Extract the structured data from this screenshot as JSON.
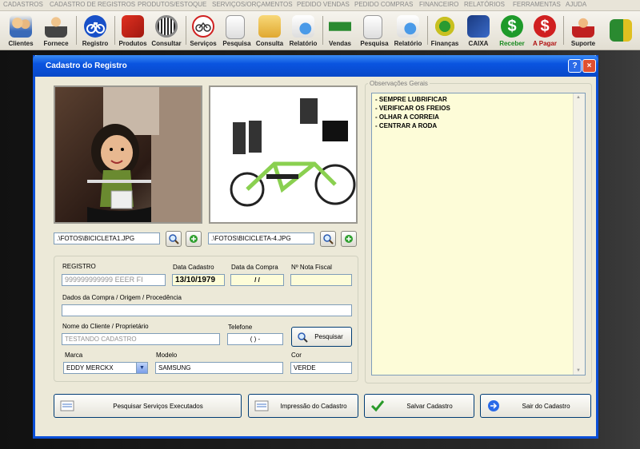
{
  "menu": [
    "CADASTROS",
    "CADASTRO DE REGISTROS",
    "PRODUTOS/ESTOQUE",
    "SERVIÇOS/ORÇAMENTOS",
    "PEDIDO VENDAS",
    "PEDIDO COMPRAS",
    "FINANCEIRO",
    "RELATÓRIOS",
    "FERRAMENTAS",
    "AJUDA"
  ],
  "toolbar": [
    "Clientes",
    "Fornece",
    "Registro",
    "Produtos",
    "Consultar",
    "Serviços",
    "Pesquisa",
    "Consulta",
    "Relatório",
    "Vendas",
    "Pesquisa",
    "Relatório",
    "Finanças",
    "CAIXA",
    "Receber",
    "A Pagar",
    "Suporte"
  ],
  "dialog": {
    "title": "Cadastro do Registro",
    "help_label": "?",
    "close_label": "×"
  },
  "photos": {
    "photo1_path": ".\\FOTOS\\BICICLETA1.JPG",
    "photo2_path": ".\\FOTOS\\BICICLETA-4.JPG"
  },
  "form": {
    "registro_label": "REGISTRO",
    "registro_value": "999999999999 EEER FI",
    "data_cadastro_label": "Data Cadastro",
    "data_cadastro_value": "13/10/1979",
    "data_compra_label": "Data da Compra",
    "data_compra_value": " /  /",
    "nota_fiscal_label": "Nº Nota Fiscal",
    "nota_fiscal_value": "",
    "dados_compra_label": "Dados da Compra / Origem / Procedência",
    "dados_compra_value": "",
    "cliente_label": "Nome do Cliente / Proprietário",
    "cliente_value": "TESTANDO CADASTRO",
    "telefone_label": "Telefone",
    "telefone_value": "(   )    -",
    "pesquisar_label": "Pesquisar",
    "marca_label": "Marca",
    "marca_value": "EDDY MERCKX",
    "modelo_label": "Modelo",
    "modelo_value": "SAMSUNG",
    "cor_label": "Cor",
    "cor_value": "VERDE"
  },
  "observacoes": {
    "label": "Observações Gerais",
    "lines": [
      "- SEMPRE LUBRIFICAR",
      "- VERIFICAR OS FREIOS",
      "- OLHAR  A CORREIA",
      "- CENTRAR A RODA"
    ]
  },
  "buttons": {
    "pesquisar_servicos": "Pesquisar Serviços Executados",
    "impressao": "Impressão do Cadastro",
    "salvar": "Salvar Cadastro",
    "sair": "Sair do Cadastro"
  },
  "colors": {
    "title_blue": "#0a54e0",
    "field_yellow": "#fdfcd8",
    "notes_yellow": "#fdfcd8"
  }
}
